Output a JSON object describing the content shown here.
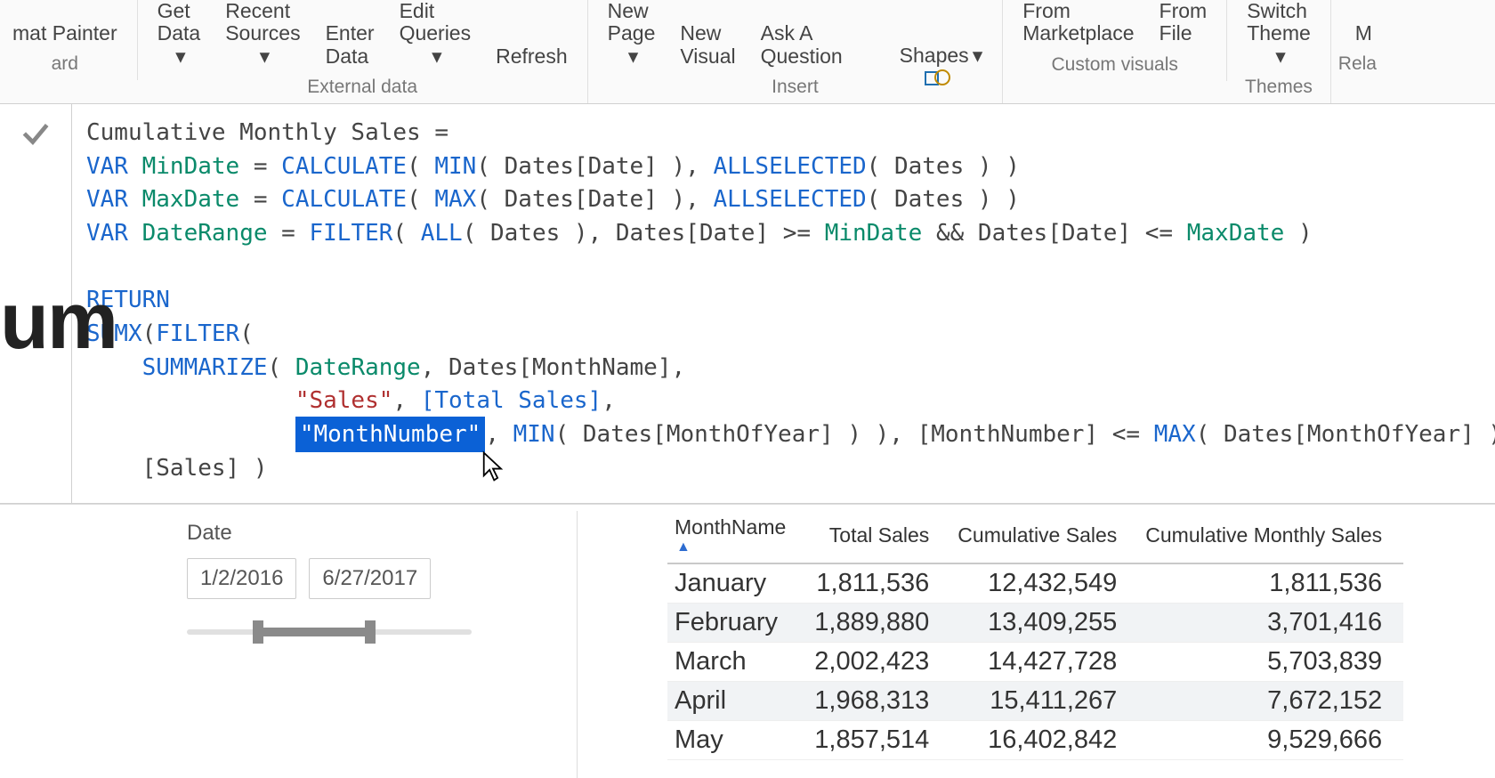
{
  "ribbon": {
    "clipboard": {
      "formatPainter": "mat Painter",
      "groupLabel": "ard"
    },
    "external": {
      "getData": "Get\nData",
      "recentSources": "Recent\nSources",
      "enterData": "Enter\nData",
      "editQueries": "Edit\nQueries",
      "refresh": "Refresh",
      "groupLabel": "External data"
    },
    "insert": {
      "newPage": "New\nPage",
      "newVisual": "New\nVisual",
      "askA": "Ask A\nQuestion",
      "shapes": "Shapes",
      "groupLabel": "Insert"
    },
    "custom": {
      "fromMarketplace": "From\nMarketplace",
      "fromFile": "From\nFile",
      "groupLabel": "Custom visuals"
    },
    "themes": {
      "switchTheme": "Switch\nTheme",
      "groupLabel": "Themes"
    },
    "rel": {
      "label": "Rela"
    }
  },
  "bigText": "um",
  "formula": {
    "name": "Cumulative Monthly Sales",
    "line1": {
      "var": "VAR",
      "id": "MinDate",
      "calc": "CALCULATE",
      "min": "MIN",
      "col": "Dates[Date]",
      "allsel": "ALLSELECTED",
      "tbl": "Dates"
    },
    "line2": {
      "var": "VAR",
      "id": "MaxDate",
      "calc": "CALCULATE",
      "max": "MAX",
      "col": "Dates[Date]",
      "allsel": "ALLSELECTED",
      "tbl": "Dates"
    },
    "line3": {
      "var": "VAR",
      "id": "DateRange",
      "filter": "FILTER",
      "all": "ALL",
      "tbl": "Dates",
      "col": "Dates[Date]",
      "min": "MinDate",
      "max": "MaxDate"
    },
    "ret": "RETURN",
    "sumx": "SUMX",
    "filter": "FILTER",
    "summarize": "SUMMARIZE",
    "dr": "DateRange",
    "monthname": "Dates[MonthName]",
    "salesStr": "\"Sales\"",
    "totalSales": "[Total Sales]",
    "monthNumStr": "\"MonthNumber\"",
    "minFn": "MIN",
    "moy": "Dates[MonthOfYear]",
    "monthNumCol": "[MonthNumber]",
    "maxFn": "MAX",
    "salesCol": "[Sales]"
  },
  "slicer": {
    "title": "Date",
    "start": "1/2/2016",
    "end": "6/27/2017"
  },
  "table": {
    "headers": {
      "c0": "MonthName",
      "c1": "Total Sales",
      "c2": "Cumulative Sales",
      "c3": "Cumulative Monthly Sales"
    },
    "rows": [
      {
        "m": "January",
        "t": "1,811,536",
        "c": "12,432,549",
        "cm": "1,811,536"
      },
      {
        "m": "February",
        "t": "1,889,880",
        "c": "13,409,255",
        "cm": "3,701,416"
      },
      {
        "m": "March",
        "t": "2,002,423",
        "c": "14,427,728",
        "cm": "5,703,839"
      },
      {
        "m": "April",
        "t": "1,968,313",
        "c": "15,411,267",
        "cm": "7,672,152"
      },
      {
        "m": "May",
        "t": "1,857,514",
        "c": "16,402,842",
        "cm": "9,529,666"
      }
    ]
  },
  "chart_data": {
    "type": "table",
    "title": "Cumulative Monthly Sales",
    "columns": [
      "MonthName",
      "Total Sales",
      "Cumulative Sales",
      "Cumulative Monthly Sales"
    ],
    "rows": [
      [
        "January",
        1811536,
        12432549,
        1811536
      ],
      [
        "February",
        1889880,
        13409255,
        3701416
      ],
      [
        "March",
        2002423,
        14427728,
        5703839
      ],
      [
        "April",
        1968313,
        15411267,
        7672152
      ],
      [
        "May",
        1857514,
        16402842,
        9529666
      ]
    ]
  }
}
